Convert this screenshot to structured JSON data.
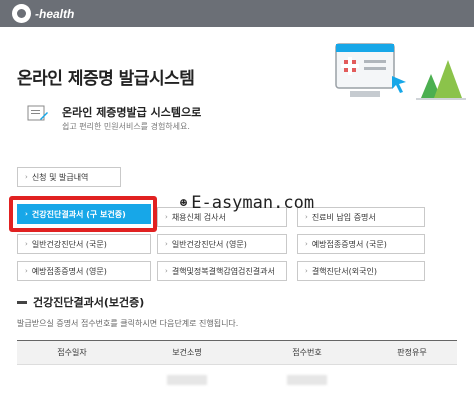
{
  "header": {
    "logo_text": "-health"
  },
  "hero": {
    "title": "온라인 제증명 발급시스템"
  },
  "sub": {
    "title": "온라인 제증명발급 시스템으로",
    "desc": "쉽고 편리한 민원서비스를 경험하세요."
  },
  "history_button": {
    "label": "신청 및 발급내역"
  },
  "cert_buttons": [
    {
      "label": "건강진단결과서 (구 보건증)",
      "active": true
    },
    {
      "label": "채용신체 검사서",
      "active": false
    },
    {
      "label": "진료비 납입 증명서",
      "active": false
    },
    {
      "label": "일반건강진단서 (국문)",
      "active": false
    },
    {
      "label": "일반건강진단서 (영문)",
      "active": false
    },
    {
      "label": "예방접종증명서 (국문)",
      "active": false
    },
    {
      "label": "예방접종증명서 (영문)",
      "active": false
    },
    {
      "label": "결핵및정복결핵감염검진결과서",
      "active": false
    },
    {
      "label": "결핵진단서(외국인)",
      "active": false
    }
  ],
  "watermark": {
    "text": "E-asyman.com"
  },
  "section": {
    "title": "건강진단결과서(보건증)",
    "desc": "발급받으실 증명서 접수번호를 클릭하시면 다음단계로 진행됩니다."
  },
  "table": {
    "headers": [
      "접수일자",
      "보건소명",
      "접수번호",
      "판정유무"
    ]
  },
  "colors": {
    "topbar": "#6b6f76",
    "active": "#17a7e8",
    "highlight": "#e12121"
  }
}
